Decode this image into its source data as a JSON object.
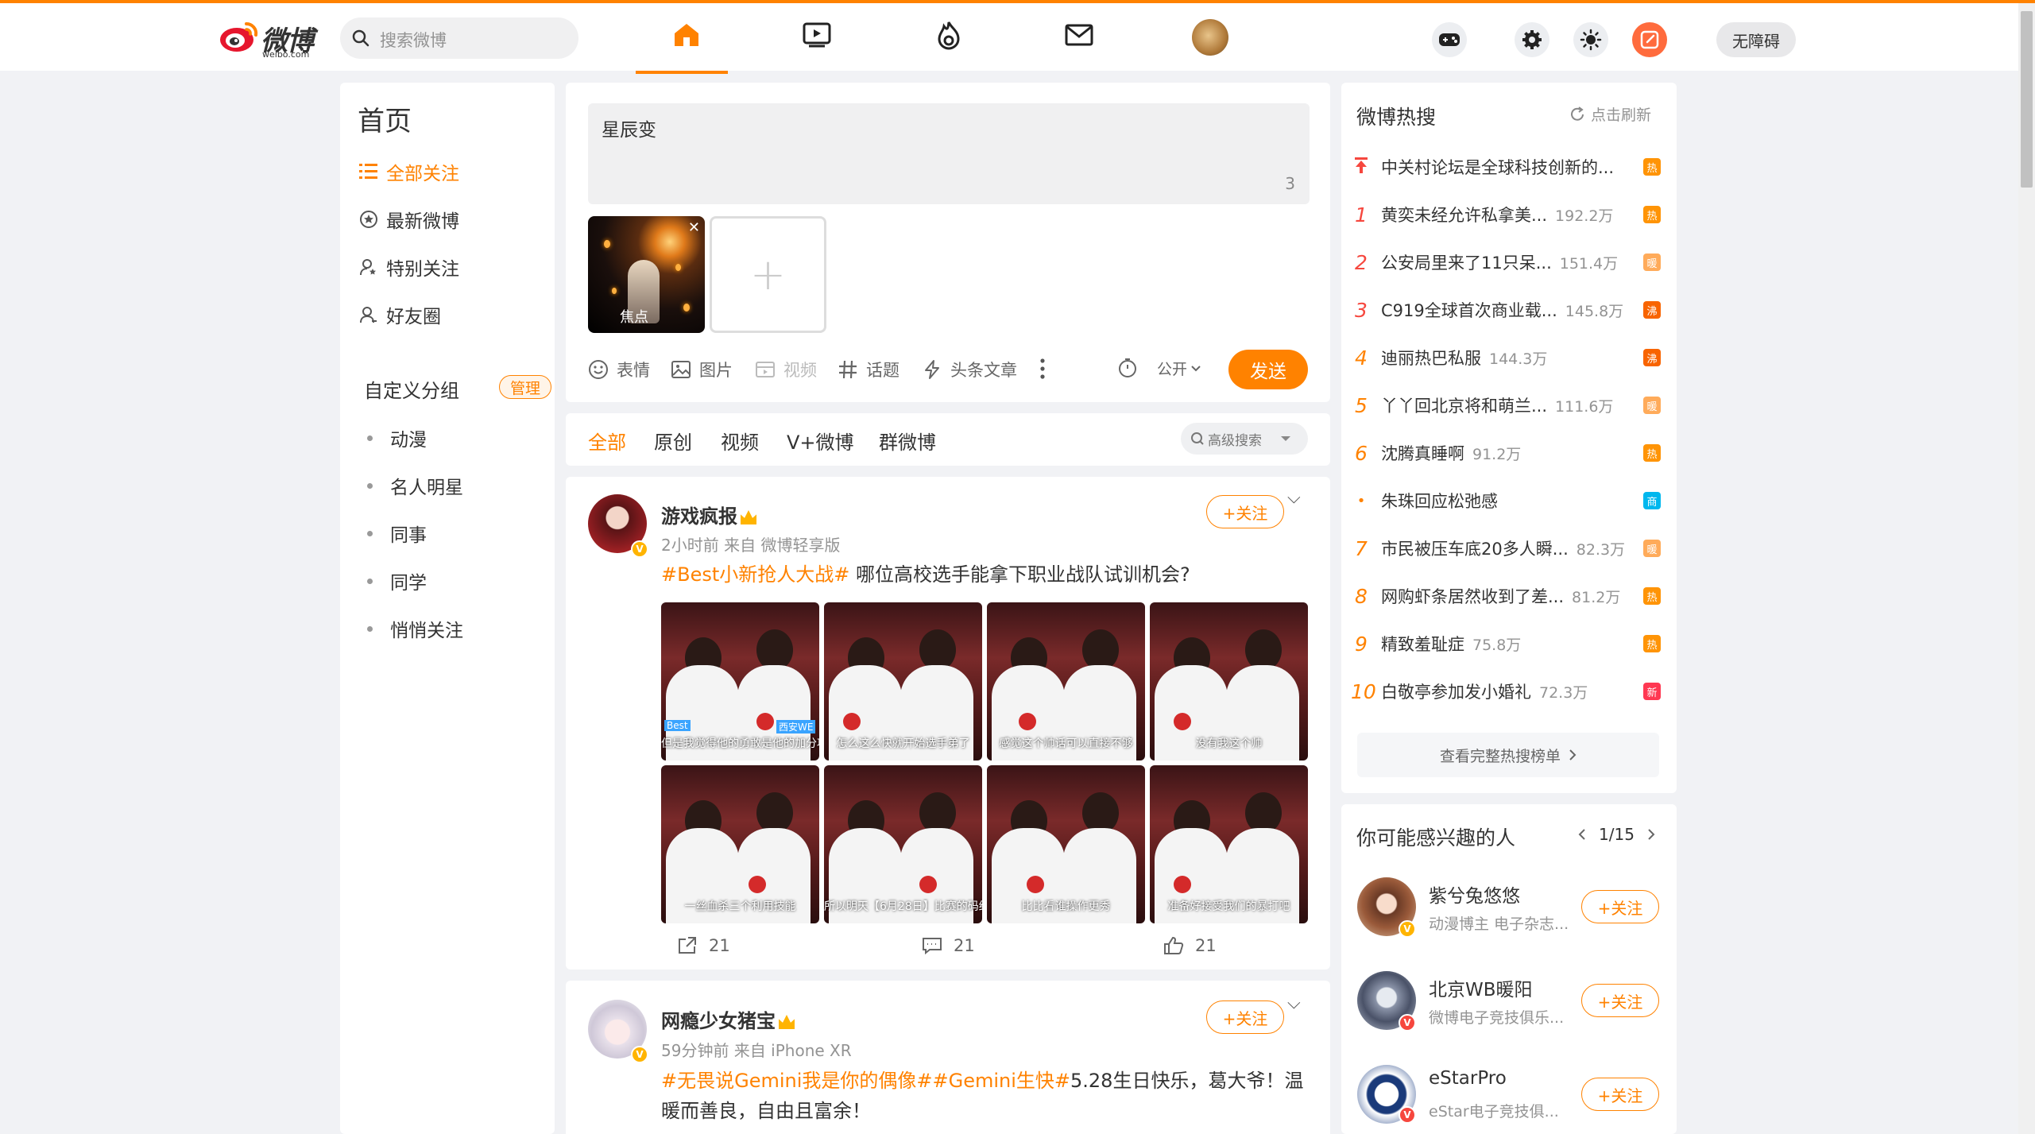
{
  "topnav": {
    "logo_text": "微博",
    "logo_sub": "weibo.com",
    "search_placeholder": "搜索微博",
    "a11y_label": "无障碍",
    "icons": [
      "home-icon",
      "video-icon",
      "hot-icon",
      "mail-icon"
    ]
  },
  "left": {
    "title": "首页",
    "items": [
      {
        "label": "全部关注",
        "icon": "list-icon"
      },
      {
        "label": "最新微博",
        "icon": "star-icon"
      },
      {
        "label": "特别关注",
        "icon": "user-star-icon"
      },
      {
        "label": "好友圈",
        "icon": "user-friends-icon"
      }
    ],
    "group_head": "自定义分组",
    "manage_label": "管理",
    "groups": [
      "动漫",
      "名人明星",
      "同事",
      "同学",
      "悄悄关注"
    ]
  },
  "compose": {
    "text": "星辰变",
    "count": "3",
    "image_focus_label": "焦点",
    "tools": [
      {
        "label": "表情",
        "icon": "emoji-icon"
      },
      {
        "label": "图片",
        "icon": "image-icon"
      },
      {
        "label": "视频",
        "icon": "video-icon"
      },
      {
        "label": "话题",
        "icon": "hash-icon"
      },
      {
        "label": "头条文章",
        "icon": "article-icon"
      }
    ],
    "visibility": "公开",
    "send_label": "发送"
  },
  "feed_tabs": {
    "tabs": [
      "全部",
      "原创",
      "视频",
      "V+微博",
      "群微博"
    ],
    "adv_search": "高级搜索"
  },
  "posts": [
    {
      "name": "游戏疯报",
      "meta": "2小时前  来自 微博轻享版",
      "follow": "+关注",
      "tag": "#Best小新抢人大战#",
      "text": " 哪位高校选手能拿下职业战队试训机会?",
      "captions": [
        "但是我觉得他的勇敢是他的加分项",
        "怎么这么快就开始选手弟了",
        "感觉这个帅话可以直接不够",
        "没有我这个帅",
        "一丝血杀三个利用技能",
        "所以明天【6月28日】比赛的码结",
        "比比看谁操作更秀",
        "准备好接受我们的暴打吧"
      ],
      "overlay_tags": [
        "Best",
        "西安WE"
      ],
      "reposts": "21",
      "comments": "21",
      "likes": "21"
    },
    {
      "name": "网瘾少女猪宝",
      "meta": "59分钟前  来自 iPhone XR",
      "follow": "+关注",
      "tag": "#无畏说Gemini我是你的偶像##Gemini生快#",
      "text": "5.28生日快乐，葛大爷！温暖而善良，自由且富余！"
    }
  ],
  "hot": {
    "title": "微博热搜",
    "refresh": "点击刷新",
    "rows": [
      {
        "rank": "",
        "text": "中关村论坛是全球科技创新的...",
        "num": "",
        "badge": "热",
        "color": "#ff9406"
      },
      {
        "rank": "1",
        "text": "黄奕未经允许私拿美...",
        "num": "192.2万",
        "badge": "热",
        "color": "#ff9406"
      },
      {
        "rank": "2",
        "text": "公安局里来了11只呆...",
        "num": "151.4万",
        "badge": "暖",
        "color": "#ffab5a"
      },
      {
        "rank": "3",
        "text": "C919全球首次商业载...",
        "num": "145.8万",
        "badge": "沸",
        "color": "#f86400"
      },
      {
        "rank": "4",
        "text": "迪丽热巴私服",
        "num": "144.3万",
        "badge": "沸",
        "color": "#f86400"
      },
      {
        "rank": "5",
        "text": "丫丫回北京将和萌兰...",
        "num": "111.6万",
        "badge": "暖",
        "color": "#ffab5a"
      },
      {
        "rank": "6",
        "text": "沈腾真睡啊",
        "num": "91.2万",
        "badge": "热",
        "color": "#ff9406"
      },
      {
        "rank": "•",
        "text": "朱珠回应松弛感",
        "num": "",
        "badge": "商",
        "color": "#00b7ee"
      },
      {
        "rank": "7",
        "text": "市民被压车底20多人瞬...",
        "num": "82.3万",
        "badge": "暖",
        "color": "#ffab5a"
      },
      {
        "rank": "8",
        "text": "网购虾条居然收到了差...",
        "num": "81.2万",
        "badge": "热",
        "color": "#ff9406"
      },
      {
        "rank": "9",
        "text": "精致羞耻症",
        "num": "75.8万",
        "badge": "热",
        "color": "#ff9406"
      },
      {
        "rank": "10",
        "text": "白敬亭参加发小婚礼",
        "num": "72.3万",
        "badge": "新",
        "color": "#ff3852"
      }
    ],
    "more": "查看完整热搜榜单"
  },
  "suggest": {
    "title": "你可能感兴趣的人",
    "page": "1/15",
    "people": [
      {
        "name": "紫兮兔悠悠",
        "desc": "动漫博主 电子杂志...",
        "follow": "+关注"
      },
      {
        "name": "北京WB暖阳",
        "desc": "微博电子竞技俱乐...",
        "follow": "+关注"
      },
      {
        "name": "eStarPro",
        "desc": "eStar电子竞技俱...",
        "follow": "+关注"
      }
    ]
  }
}
